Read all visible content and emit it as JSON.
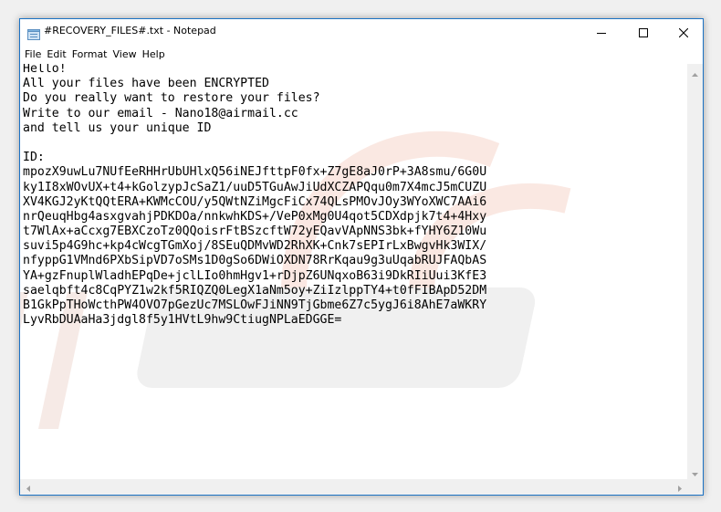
{
  "window": {
    "title": "#RECOVERY_FILES#.txt - Notepad"
  },
  "menu": {
    "items": [
      "File",
      "Edit",
      "Format",
      "View",
      "Help"
    ]
  },
  "document": {
    "lines": [
      "Hello!",
      "All your files have been ENCRYPTED",
      "Do you really want to restore your files?",
      "Write to our email - Nano18@airmail.cc",
      "and tell us your unique ID",
      "",
      "ID:",
      "mpozX9uwLu7NUfEeRHHrUbUHlxQ56iNEJfttpF0fx+Z7gE8aJ0rP+3A8smu/6G0U",
      "ky1I8xWOvUX+t4+kGolzypJcSaZ1/uuD5TGuAwJiUdXCZAPQqu0m7X4mcJ5mCUZU",
      "XV4KGJ2yKtQQtERA+KWMcCOU/y5QWtNZiMgcFiCx74QLsPMOvJOy3WYoXWC7AAi6",
      "nrQeuqHbg4asxgvahjPDKDOa/nnkwhKDS+/VeP0xMg0U4qot5CDXdpjk7t4+4Hxy",
      "t7WlAx+aCcxg7EBXCzoTz0QQoisrFtBSzcftW72yEQavVApNNS3bk+fYHY6Z10Wu",
      "suvi5p4G9hc+kp4cWcgTGmXoj/8SEuQDMvWD2RhXK+Cnk7sEPIrLxBwgvHk3WIX/",
      "nfyppG1VMnd6PXbSipVD7oSMs1D0gSo6DWiOXDN78RrKqau9g3uUqabRUJFAQbAS",
      "YA+gzFnuplWladhEPqDe+jclLIo0hmHgv1+rDjpZ6UNqxoB63i9DkRIiUui3KfE3",
      "saelqbft4c8CqPYZ1w2kf5RIQZQ0LegX1aNm5oy+ZiIzlppTY4+t0fFIBApD52DM",
      "B1GkPpTHoWcthPW4OVO7pGezUc7MSLOwFJiNN9TjGbme6Z7c5ygJ6i8AhE7aWKRY",
      "LyvRbDUAaHa3jdgl8f5y1HVtL9hw9CtiugNPLaEDGGE="
    ]
  },
  "icons": {
    "app": "notepad-icon",
    "minimize": "minimize-icon",
    "maximize": "maximize-icon",
    "close": "close-icon"
  },
  "colors": {
    "accent_border": "#1b72c4",
    "text": "#000000",
    "background": "#ffffff",
    "scrollbar": "#f0f0f0"
  }
}
